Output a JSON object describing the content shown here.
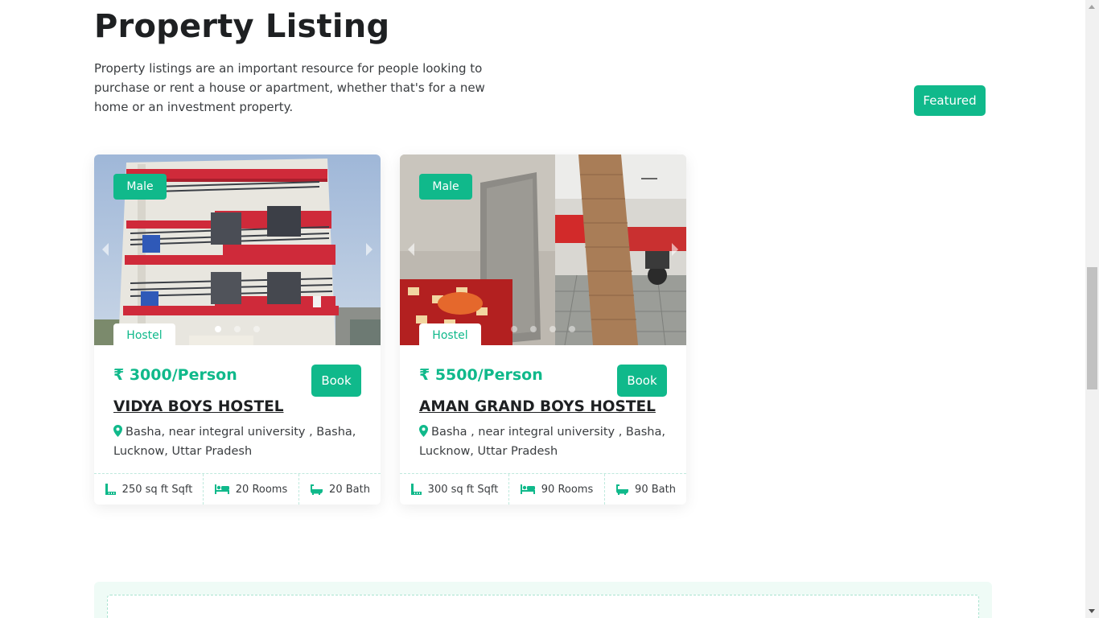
{
  "section": {
    "title": "Property Listing",
    "description": "Property listings are an important resource for people looking to purchase or rent a house or apartment, whether that's for a new home or an investment property.",
    "featured_label": "Featured"
  },
  "listings": [
    {
      "gender": "Male",
      "type": "Hostel",
      "price": "₹ 3000/Person",
      "book_label": "Book",
      "name": "VIDYA BOYS HOSTEL",
      "address": "Basha, near integral university , Basha, Lucknow, Uttar Pradesh",
      "area": "250 sq ft Sqft",
      "rooms": "20 Rooms",
      "baths": "20 Bath",
      "slides": 3,
      "active_slide": 1
    },
    {
      "gender": "Male",
      "type": "Hostel",
      "price": "₹ 5500/Person",
      "book_label": "Book",
      "name": "AMAN GRAND BOYS HOSTEL",
      "address": "Basha , near integral university , Basha, Lucknow, Uttar Pradesh",
      "area": "300 sq ft Sqft",
      "rooms": "90 Rooms",
      "baths": "90 Bath",
      "slides": 4,
      "active_slide": 0
    }
  ],
  "colors": {
    "accent": "#10b98b",
    "heading": "#1e2022",
    "body_text": "#3a3d40",
    "panel_bg": "#effbf6"
  },
  "icons": {
    "location": "map-pin-icon",
    "area": "ruler-icon",
    "rooms": "bed-icon",
    "baths": "bathtub-icon"
  }
}
